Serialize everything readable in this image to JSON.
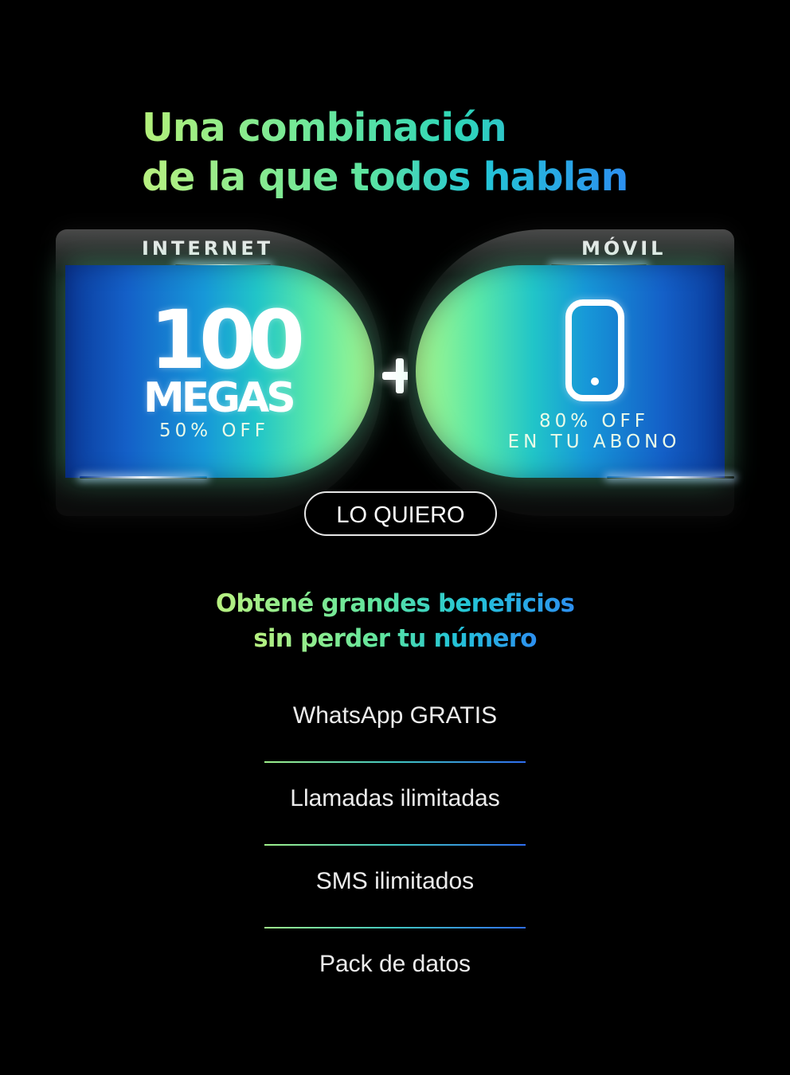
{
  "headline": {
    "line1": "Una combinación",
    "line2": "de la que todos hablan"
  },
  "internet_card": {
    "label": "INTERNET",
    "amount": "100",
    "unit": "MEGAS",
    "discount": "50% OFF"
  },
  "mobile_card": {
    "label": "MÓVIL",
    "icon": "smartphone-icon",
    "discount_line1": "80% OFF",
    "discount_line2": "EN TU ABONO"
  },
  "plus_symbol": "plus-icon",
  "cta": {
    "label": "LO QUIERO"
  },
  "subheadline": {
    "line1": "Obtené grandes beneficios",
    "line2": "sin perder tu número"
  },
  "benefits": [
    "WhatsApp GRATIS",
    "Llamadas ilimitadas",
    "SMS ilimitados",
    "Pack de datos"
  ],
  "colors": {
    "background": "#000000",
    "gradient_green": "#a9f78c",
    "gradient_teal": "#21c5c8",
    "gradient_blue": "#1460c8"
  }
}
